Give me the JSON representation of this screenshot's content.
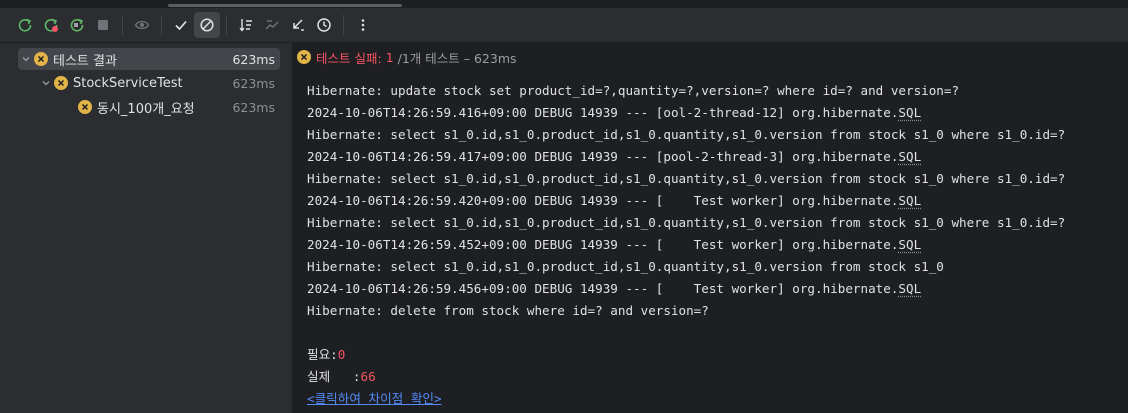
{
  "toolbar": {
    "buttons": [
      {
        "name": "rerun-icon"
      },
      {
        "name": "rerun-failed-icon"
      },
      {
        "name": "toggle-auto-test-icon"
      },
      {
        "name": "stop-icon"
      },
      {
        "name": "show-ignored-icon"
      },
      {
        "name": "show-passed-icon"
      },
      {
        "name": "show-ignored-filter-icon"
      },
      {
        "name": "sort-alpha-icon"
      },
      {
        "name": "sort-duration-icon"
      },
      {
        "name": "collapse-all-icon"
      },
      {
        "name": "history-icon"
      },
      {
        "name": "more-options-icon"
      }
    ]
  },
  "tree": {
    "root": {
      "label": "테스트 결과",
      "duration": "623ms"
    },
    "suite": {
      "label": "StockServiceTest",
      "duration": "623ms"
    },
    "test": {
      "label": "동시_100개_요청",
      "duration": "623ms"
    }
  },
  "status": {
    "fail_label": "테스트 실패:",
    "fail_count": "1",
    "total": "/1개 테스트 – 623ms"
  },
  "console": {
    "lines": [
      "Hibernate: update stock set product_id=?,quantity=?,version=? where id=? and version=?",
      "2024-10-06T14:26:59.416+09:00 DEBUG 14939 --- [ool-2-thread-12] org.hibernate.",
      "Hibernate: select s1_0.id,s1_0.product_id,s1_0.quantity,s1_0.version from stock s1_0 where s1_0.id=?",
      "2024-10-06T14:26:59.417+09:00 DEBUG 14939 --- [pool-2-thread-3] org.hibernate.",
      "Hibernate: select s1_0.id,s1_0.product_id,s1_0.quantity,s1_0.version from stock s1_0 where s1_0.id=?",
      "2024-10-06T14:26:59.420+09:00 DEBUG 14939 --- [    Test worker] org.hibernate.",
      "Hibernate: select s1_0.id,s1_0.product_id,s1_0.quantity,s1_0.version from stock s1_0 where s1_0.id=?",
      "2024-10-06T14:26:59.452+09:00 DEBUG 14939 --- [    Test worker] org.hibernate.",
      "Hibernate: select s1_0.id,s1_0.product_id,s1_0.quantity,s1_0.version from stock s1_0",
      "2024-10-06T14:26:59.456+09:00 DEBUG 14939 --- [    Test worker] org.hibernate.",
      "Hibernate: delete from stock where id=? and version=?"
    ],
    "sql_suffix": "SQL",
    "expected_label": "필요:",
    "expected_value": "0",
    "actual_label": "실제   :",
    "actual_value": "66",
    "diff_link": "<클릭하여 차이점 확인>"
  },
  "colors": {
    "fail": "#f75464",
    "warning_icon": "#e2b347",
    "link": "#548af7"
  }
}
